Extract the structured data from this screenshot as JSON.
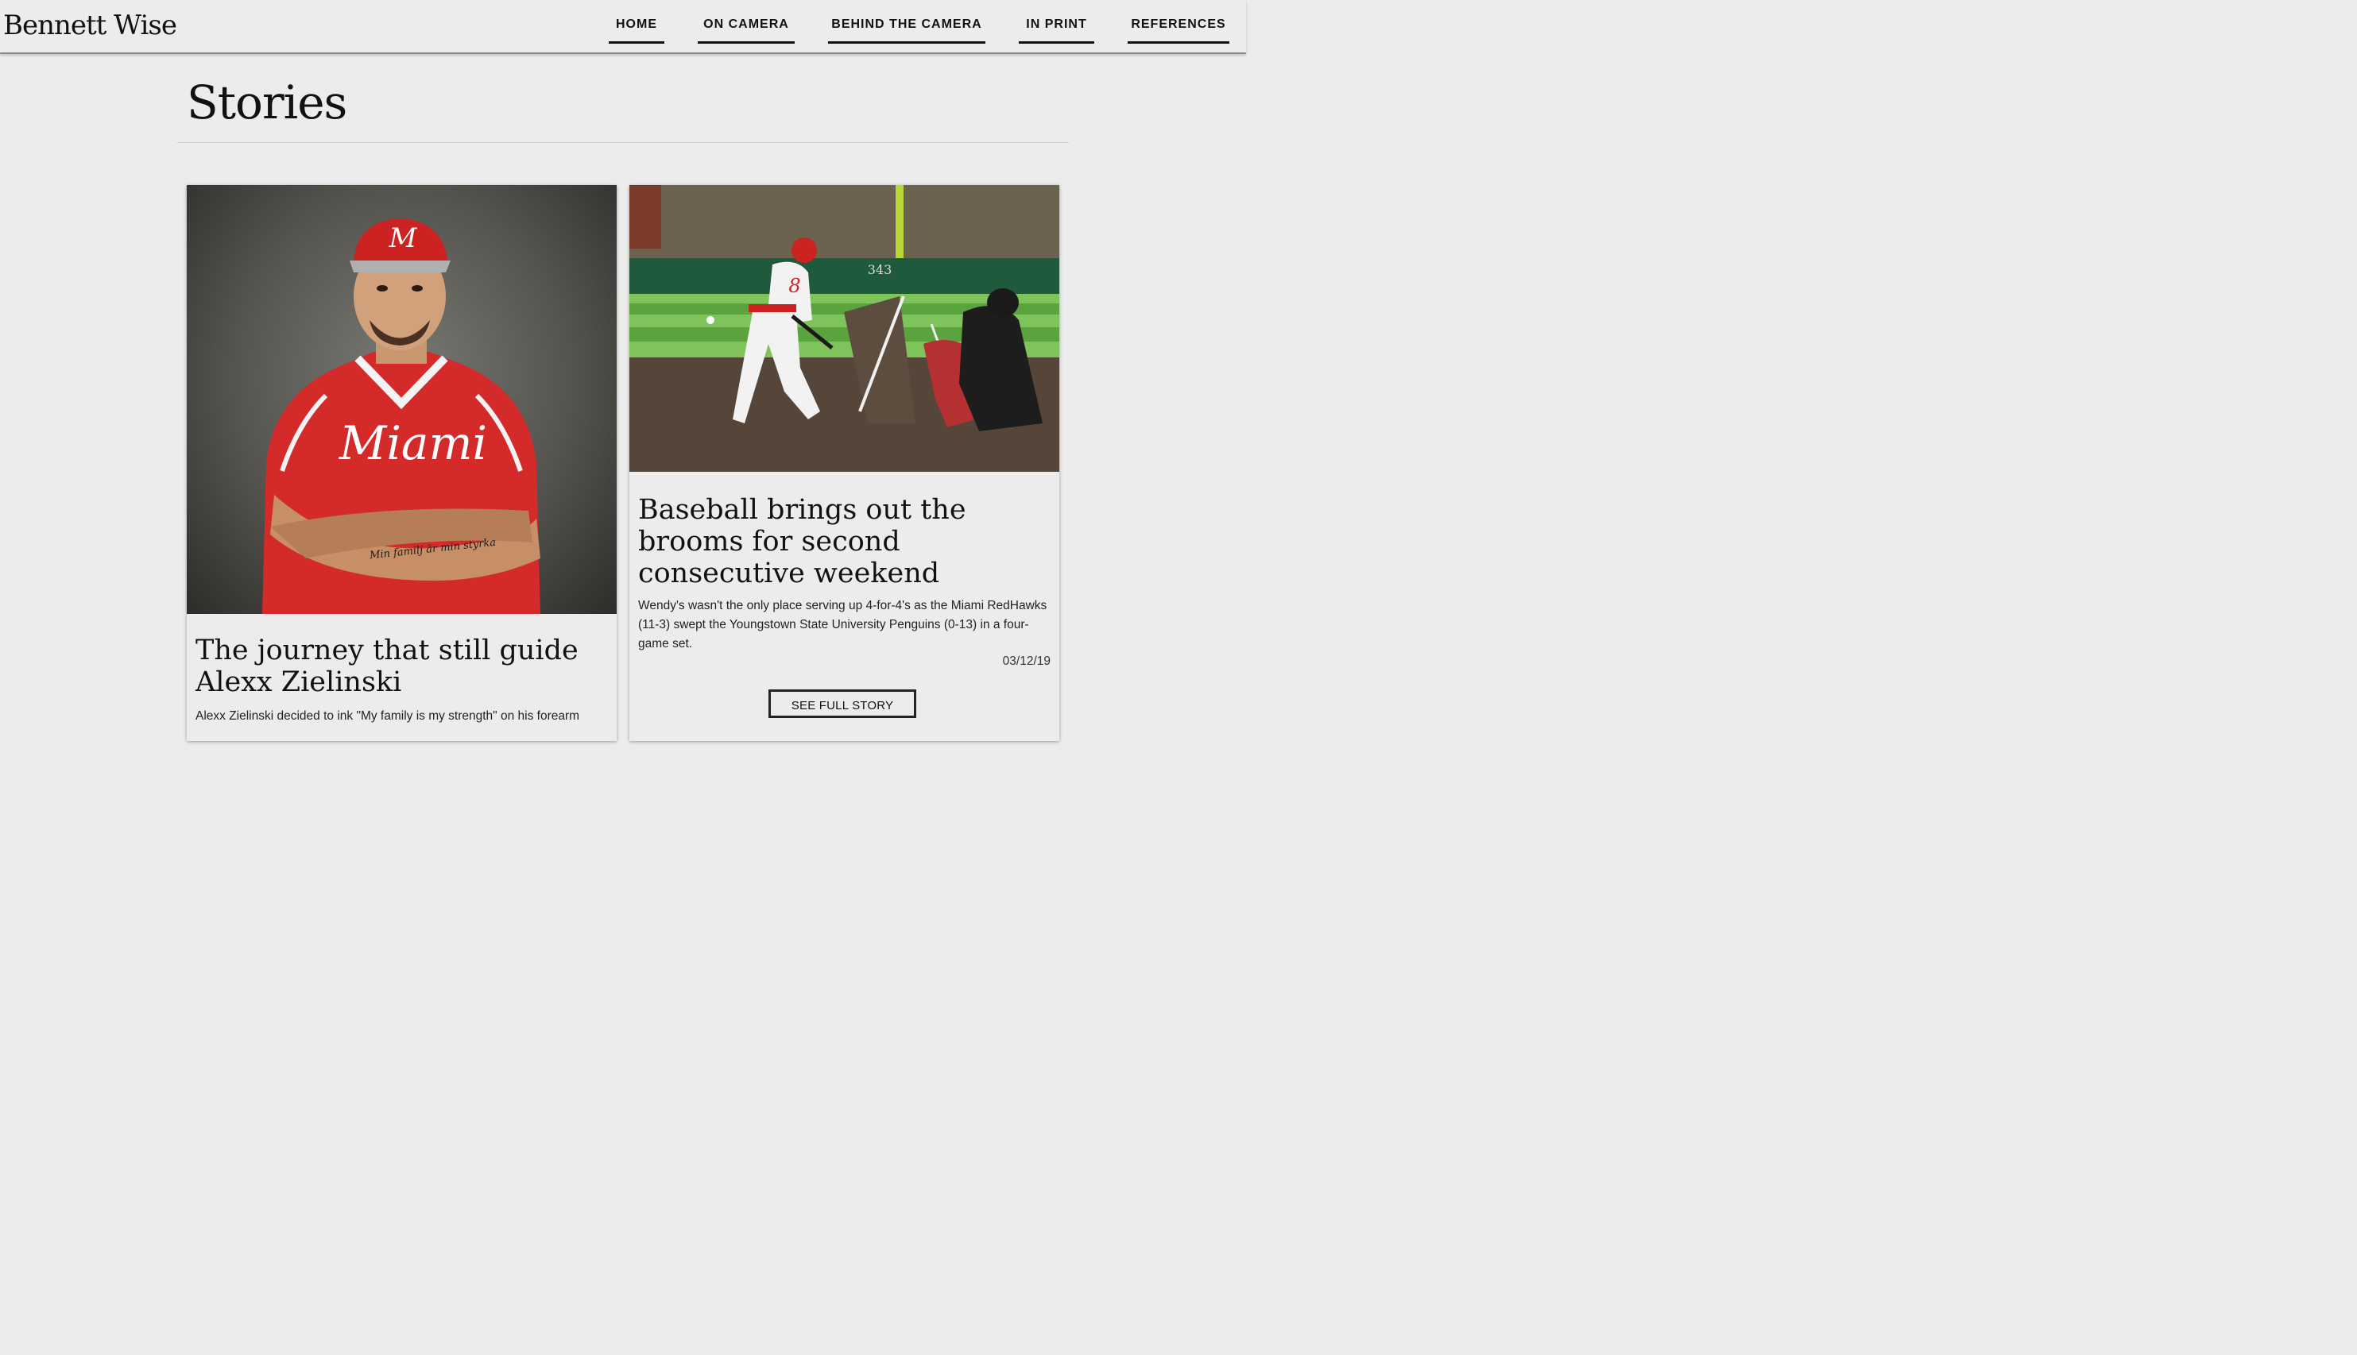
{
  "header": {
    "brand": "Bennett Wise",
    "nav": [
      {
        "label": "HOME"
      },
      {
        "label": "ON CAMERA"
      },
      {
        "label": "BEHIND THE CAMERA"
      },
      {
        "label": "IN PRINT"
      },
      {
        "label": "REFERENCES"
      }
    ]
  },
  "page": {
    "title": "Stories"
  },
  "stories": [
    {
      "headline": "The journey that still guide Alexx Zielinski",
      "summary": "Alexx Zielinski decided to ink \"My family is my strength\" on his forearm",
      "photo": {
        "cap_logo": "M",
        "jersey_text": "Miami",
        "tattoo_text": "Min familj är min styrka"
      }
    },
    {
      "headline": "Baseball brings out the brooms for second consecutive weekend",
      "summary": "Wendy's wasn't the only place serving up 4-for-4's as the Miami RedHawks (11-3) swept the Youngstown State University Penguins (0-13) in a four-game set.",
      "date": "03/12/19",
      "button": "SEE FULL STORY",
      "photo": {
        "fence_number": "343",
        "jersey_number": "8"
      }
    }
  ]
}
